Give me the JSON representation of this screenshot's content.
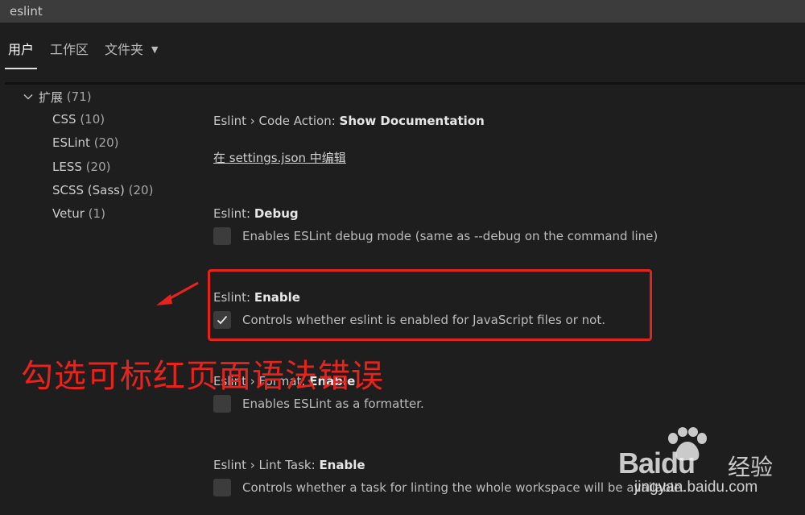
{
  "search": {
    "value": "eslint"
  },
  "tabs": [
    {
      "label": "用户",
      "active": true
    },
    {
      "label": "工作区",
      "active": false
    },
    {
      "label": "文件夹",
      "active": false
    }
  ],
  "toc": {
    "group": {
      "label": "扩展",
      "count": "(71)"
    },
    "items": [
      {
        "label": "CSS",
        "count": "(10)"
      },
      {
        "label": "ESLint",
        "count": "(20)"
      },
      {
        "label": "LESS",
        "count": "(20)"
      },
      {
        "label": "SCSS (Sass)",
        "count": "(20)"
      },
      {
        "label": "Vetur",
        "count": "(1)"
      }
    ]
  },
  "settings": {
    "code_action": {
      "category": "Eslint › Code Action: ",
      "name": "Show Documentation",
      "link": "在 settings.json 中编辑"
    },
    "debug": {
      "category": "Eslint: ",
      "name": "Debug",
      "desc": "Enables ESLint debug mode (same as --debug on the command line)",
      "checked": false
    },
    "enable": {
      "category": "Eslint: ",
      "name": "Enable",
      "desc": "Controls whether eslint is enabled for JavaScript files or not.",
      "checked": true
    },
    "format": {
      "category": "Eslint › Format: ",
      "name": "Enable",
      "desc": "Enables ESLint as a formatter.",
      "checked": false
    },
    "lint_task": {
      "category": "Eslint › Lint Task: ",
      "name": "Enable",
      "desc": "Controls whether a task for linting the whole workspace will be available.",
      "checked": false
    }
  },
  "annotation": {
    "text": "勾选可标红页面语法错误",
    "color": "#e8231d"
  },
  "watermark": {
    "brand": "Bai",
    "brand2": "du",
    "suffix": "经验",
    "url": "jingyan.baidu.com"
  }
}
